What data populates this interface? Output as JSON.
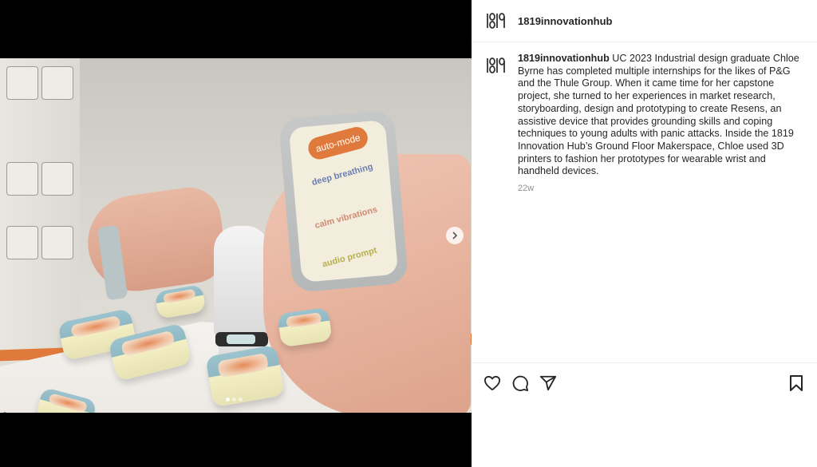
{
  "post": {
    "username": "1819innovationhub",
    "caption": "UC 2023 Industrial design graduate Chloe Byrne has completed multiple internships for the likes of P&G and the Thule Group. When it came time for her capstone project, she turned to her experiences in market research, storyboarding, design and prototyping to create Resens, an assistive device that provides grounding skills and coping techniques to young adults with panic attacks. Inside the 1819 Innovation Hub’s Ground Floor Makerspace, Chloe used 3D printers to fashion her prototypes for wearable wrist and handheld devices.",
    "timestamp": "22w"
  },
  "media": {
    "device_labels": {
      "mode": "auto-mode",
      "option1": "deep breathing",
      "option2": "calm vibrations",
      "option3": "audio prompt"
    },
    "carousel_position": 1,
    "carousel_count": 3,
    "next_icon": "chevron-right-icon"
  },
  "actions": {
    "like_icon": "heart-icon",
    "comment_icon": "comment-icon",
    "share_icon": "send-icon",
    "save_icon": "bookmark-icon"
  },
  "colors": {
    "accent_orange": "#e07a3c",
    "pod_blue": "#9cc4cf",
    "pod_cream": "#f3efc4"
  }
}
